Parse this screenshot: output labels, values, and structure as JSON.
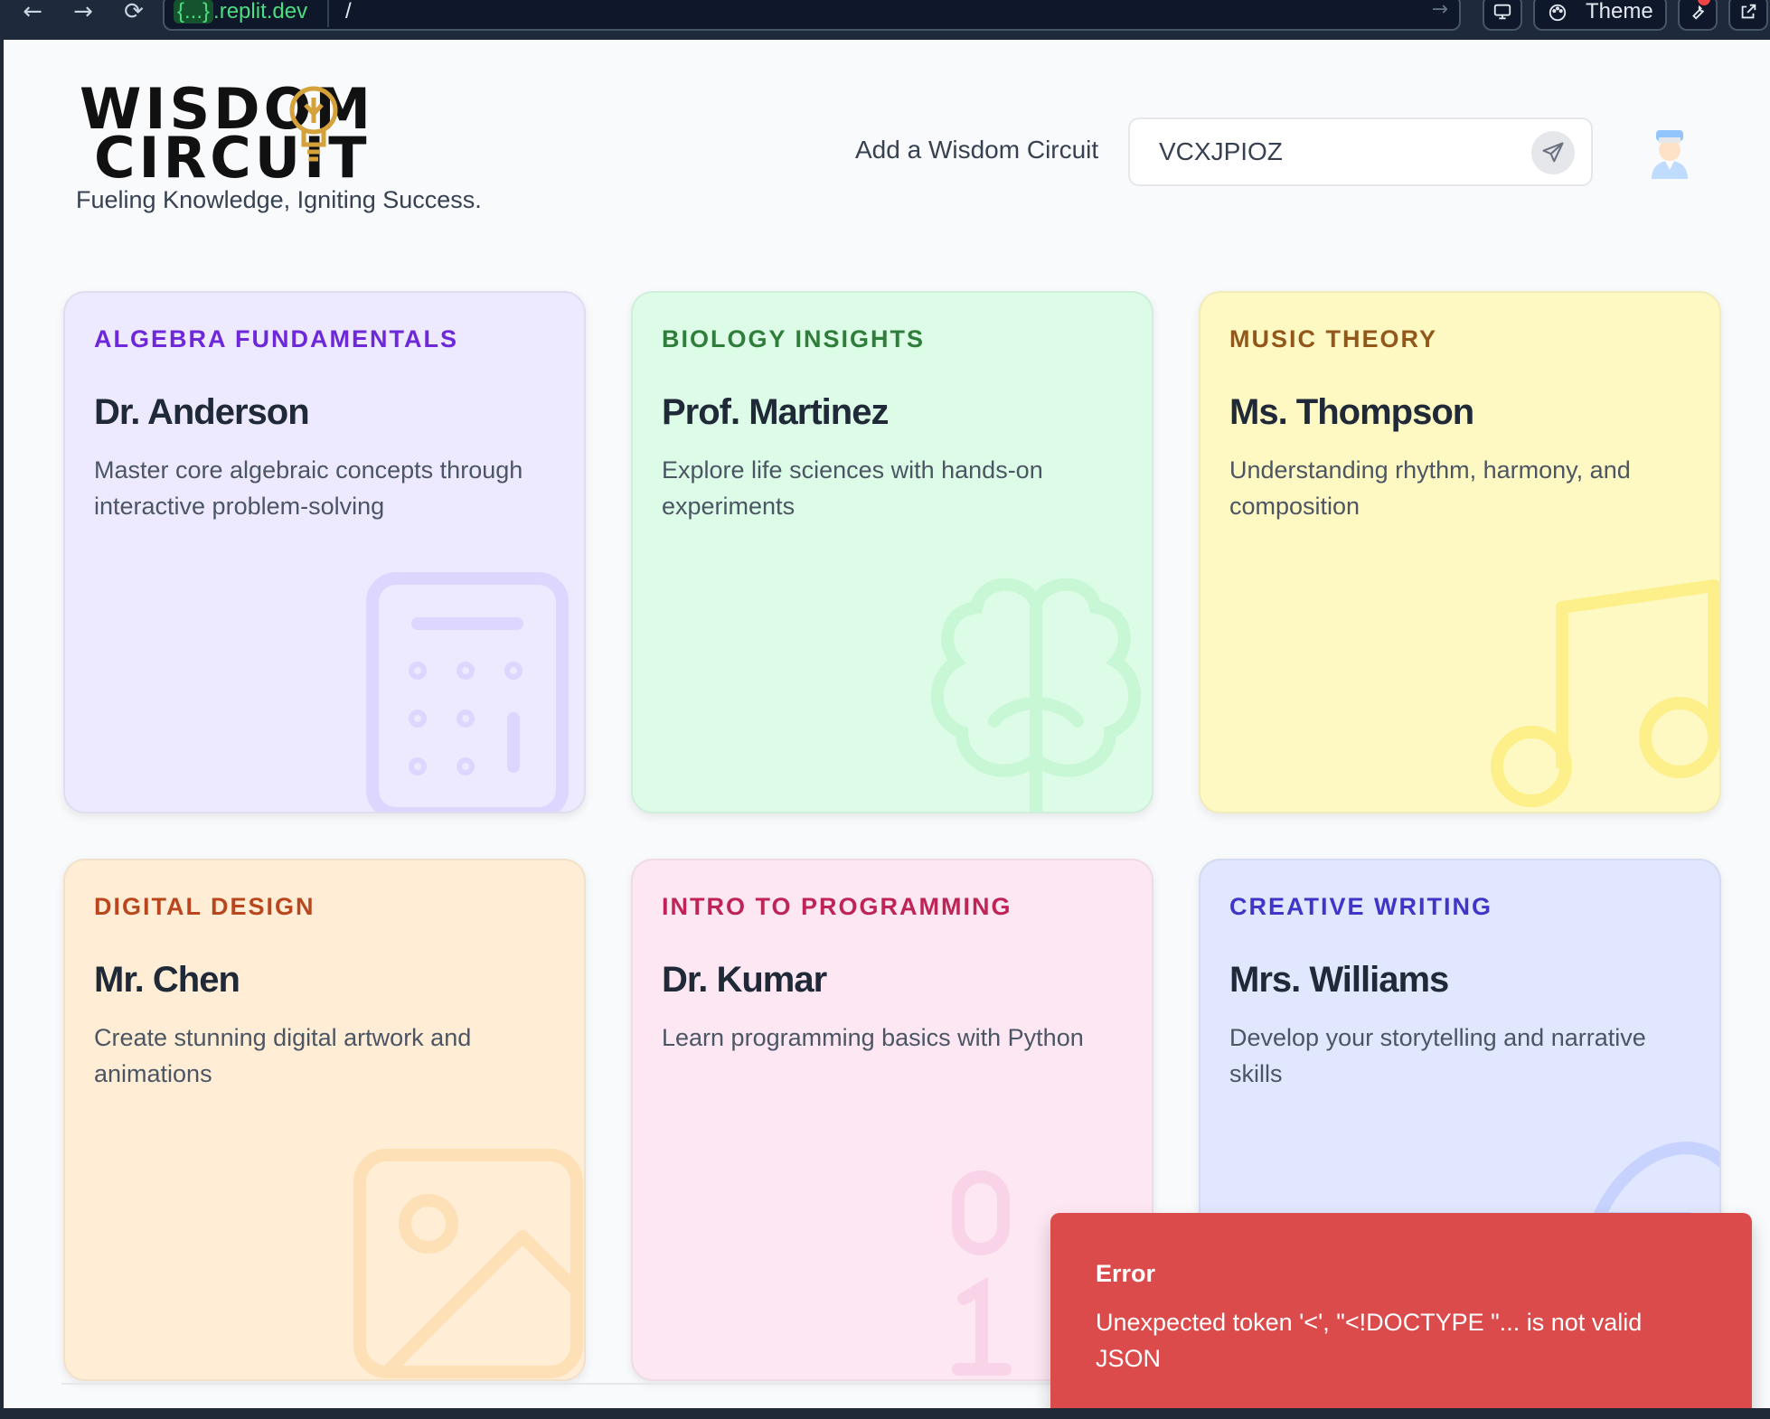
{
  "browser": {
    "url_host_braces": "{...}",
    "url_host_domain": ".replit.dev",
    "url_path": "/",
    "theme_label": "Theme"
  },
  "header": {
    "logo_line1": "WISDOM",
    "logo_line2": "CIRCUIT",
    "tagline": "Fueling Knowledge, Igniting Success.",
    "add_label": "Add a Wisdom Circuit",
    "code_value": "VCXJPIOZ"
  },
  "cards": [
    {
      "subject": "ALGEBRA FUNDAMENTALS",
      "teacher": "Dr. Anderson",
      "description": "Master core algebraic concepts through interactive problem-solving",
      "icon": "calculator-icon",
      "bg": "#ede9fe",
      "accent": "#6d28d9",
      "icon_color": "#ddd6fe"
    },
    {
      "subject": "BIOLOGY INSIGHTS",
      "teacher": "Prof. Martinez",
      "description": "Explore life sciences with hands-on experiments",
      "icon": "brain-icon",
      "bg": "#dcfce7",
      "accent": "#2f7d3a",
      "icon_color": "#c7f7d4"
    },
    {
      "subject": "MUSIC THEORY",
      "teacher": "Ms. Thompson",
      "description": "Understanding rhythm, harmony, and composition",
      "icon": "music-note-icon",
      "bg": "#fef9c3",
      "accent": "#92581b",
      "icon_color": "#fdf08a"
    },
    {
      "subject": "DIGITAL DESIGN",
      "teacher": "Mr. Chen",
      "description": "Create stunning digital artwork and animations",
      "icon": "image-icon",
      "bg": "#ffedd5",
      "accent": "#b9461c",
      "icon_color": "#fde0b6"
    },
    {
      "subject": "INTRO TO PROGRAMMING",
      "teacher": "Dr. Kumar",
      "description": "Learn programming basics with Python",
      "icon": "binary-icon",
      "bg": "#fce7f3",
      "accent": "#be2456",
      "icon_color": "#f9d4e8"
    },
    {
      "subject": "CREATIVE WRITING",
      "teacher": "Mrs. Williams",
      "description": "Develop your storytelling and narrative skills",
      "icon": "feather-icon",
      "bg": "#e0e7ff",
      "accent": "#3f36c7",
      "icon_color": "#c7d2fe"
    }
  ],
  "toast": {
    "title": "Error",
    "message": "Unexpected token '<', \"<!DOCTYPE \"... is not valid JSON"
  }
}
